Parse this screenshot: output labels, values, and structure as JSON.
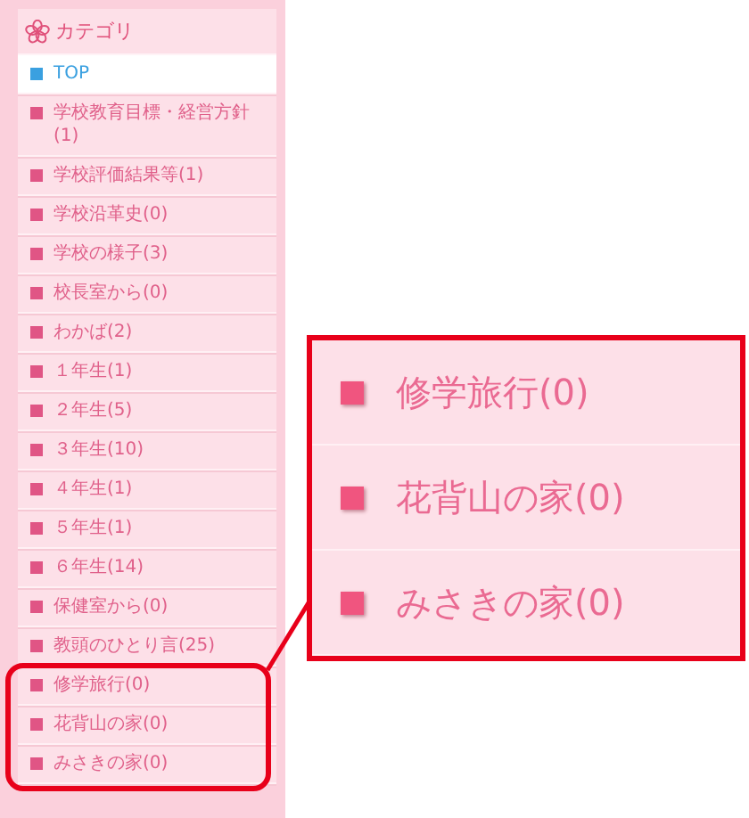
{
  "sidebar": {
    "title": "カテゴリ",
    "items": [
      {
        "label": "TOP",
        "selected": true
      },
      {
        "label": "学校教育目標・経営方針(1)",
        "selected": false
      },
      {
        "label": "学校評価結果等(1)",
        "selected": false
      },
      {
        "label": "学校沿革史(0)",
        "selected": false
      },
      {
        "label": "学校の様子(3)",
        "selected": false
      },
      {
        "label": "校長室から(0)",
        "selected": false
      },
      {
        "label": "わかば(2)",
        "selected": false
      },
      {
        "label": "１年生(1)",
        "selected": false
      },
      {
        "label": "２年生(5)",
        "selected": false
      },
      {
        "label": "３年生(10)",
        "selected": false
      },
      {
        "label": "４年生(1)",
        "selected": false
      },
      {
        "label": "５年生(1)",
        "selected": false
      },
      {
        "label": "６年生(14)",
        "selected": false
      },
      {
        "label": "保健室から(0)",
        "selected": false
      },
      {
        "label": "教頭のひとり言(25)",
        "selected": false
      },
      {
        "label": "修学旅行(0)",
        "selected": false
      },
      {
        "label": "花背山の家(0)",
        "selected": false
      },
      {
        "label": "みさきの家(0)",
        "selected": false
      }
    ]
  },
  "callout": {
    "items": [
      "修学旅行(0)",
      "花背山の家(0)",
      "みさきの家(0)"
    ]
  }
}
